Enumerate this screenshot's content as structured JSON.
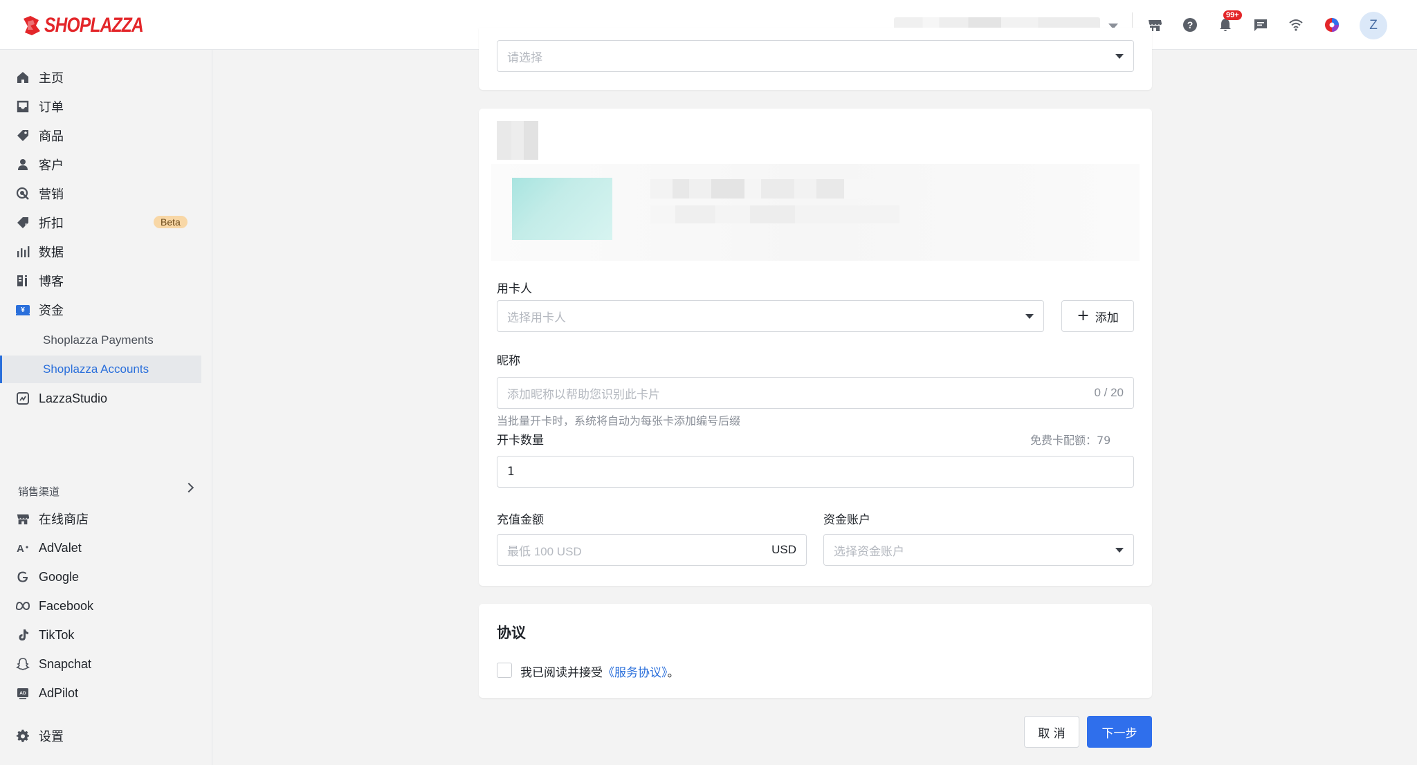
{
  "brand": {
    "name": "SHOPLAZZA",
    "color": "#e3262a"
  },
  "topbar": {
    "notifications_badge": "99+",
    "avatar_initial": "Z",
    "icons": [
      "store-icon",
      "help-icon",
      "bell-icon",
      "chat-icon",
      "wifi-icon",
      "app-icon"
    ]
  },
  "sidebar": {
    "items": [
      {
        "label": "主页",
        "icon": "home-icon"
      },
      {
        "label": "订单",
        "icon": "inbox-icon"
      },
      {
        "label": "商品",
        "icon": "tag-icon"
      },
      {
        "label": "客户",
        "icon": "person-icon"
      },
      {
        "label": "营销",
        "icon": "marketing-icon"
      },
      {
        "label": "折扣",
        "icon": "discount-icon",
        "badge": "Beta"
      },
      {
        "label": "数据",
        "icon": "bar-chart-icon"
      },
      {
        "label": "博客",
        "icon": "blog-icon"
      },
      {
        "label": "资金",
        "icon": "funds-icon"
      }
    ],
    "sub_items": [
      {
        "label": "Shoplazza Payments",
        "active": false
      },
      {
        "label": "Shoplazza Accounts",
        "active": true
      }
    ],
    "lazzastudio": {
      "label": "LazzaStudio",
      "icon": "studio-icon"
    },
    "sales_channels_label": "销售渠道",
    "channels": [
      {
        "label": "在线商店",
        "icon": "store-icon"
      },
      {
        "label": "AdValet",
        "icon": "advalet-icon"
      },
      {
        "label": "Google",
        "icon": "google-icon"
      },
      {
        "label": "Facebook",
        "icon": "meta-icon"
      },
      {
        "label": "TikTok",
        "icon": "tiktok-icon"
      },
      {
        "label": "Snapchat",
        "icon": "snapchat-icon"
      },
      {
        "label": "AdPilot",
        "icon": "adpilot-icon"
      }
    ],
    "settings": {
      "label": "设置",
      "icon": "gear-icon"
    }
  },
  "form": {
    "top_select_placeholder": "请选择",
    "cardholder": {
      "label": "用卡人",
      "placeholder": "选择用卡人",
      "add_button": "添加"
    },
    "nickname": {
      "label": "昵称",
      "placeholder": "添加昵称以帮助您识别此卡片",
      "counter": "0 / 20",
      "hint": "当批量开卡时，系统将自动为每张卡添加编号后缀"
    },
    "card_count": {
      "label": "开卡数量",
      "quota": "免费卡配额：79",
      "value": "1"
    },
    "recharge": {
      "label": "充值金额",
      "placeholder": "最低 100 USD",
      "currency": "USD"
    },
    "fund_account": {
      "label": "资金账户",
      "placeholder": "选择资金账户"
    }
  },
  "agreement": {
    "title": "协议",
    "text_prefix": "我已阅读并接受",
    "link": "《服务协议》",
    "text_suffix": "。"
  },
  "footer": {
    "cancel": "取 消",
    "next": "下一步"
  }
}
